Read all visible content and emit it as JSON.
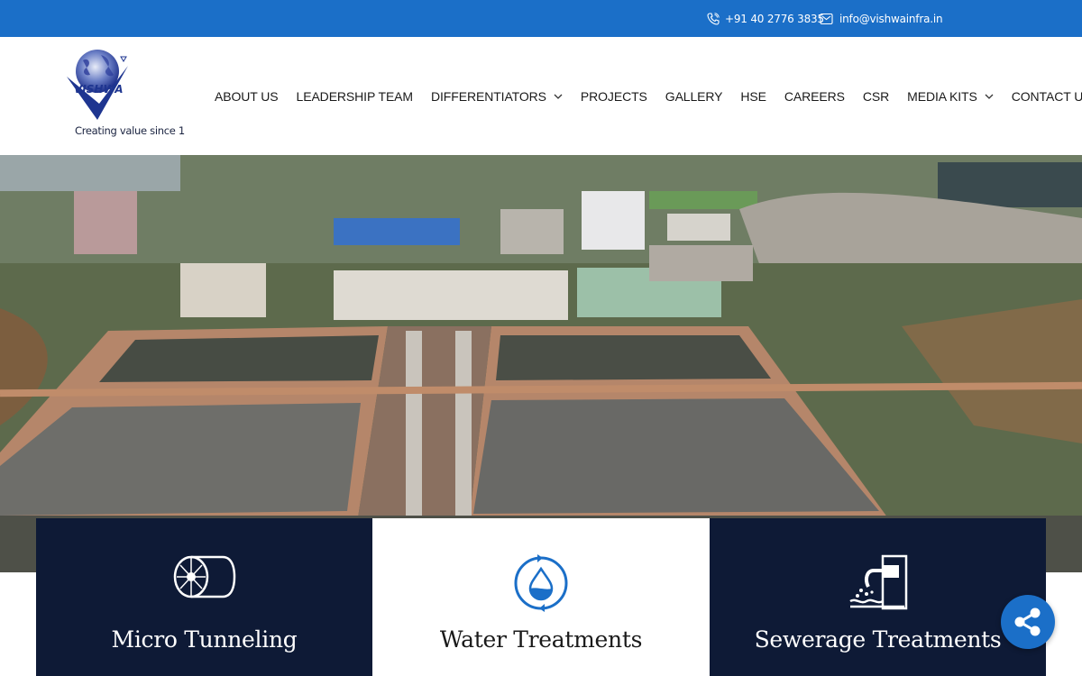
{
  "topbar": {
    "phone": "+91 40 2776 3835",
    "email": "info@vishwainfra.in",
    "phone_icon": "phone-icon",
    "email_icon": "mail-icon"
  },
  "header": {
    "logo_text": "VISHWA",
    "tagline": "Creating value since 1",
    "nav": [
      {
        "label": "ABOUT US"
      },
      {
        "label": "LEADERSHIP TEAM"
      },
      {
        "label": "DIFFERENTIATORS",
        "dropdown": true
      },
      {
        "label": "PROJECTS"
      },
      {
        "label": "GALLERY"
      },
      {
        "label": "HSE"
      },
      {
        "label": "CAREERS"
      },
      {
        "label": "CSR"
      },
      {
        "label": "MEDIA KITS",
        "dropdown": true
      },
      {
        "label": "CONTACT US"
      }
    ]
  },
  "cards": [
    {
      "title": "Micro Tunneling",
      "icon": "tunnel-icon",
      "theme": "dark"
    },
    {
      "title": "Water Treatments",
      "icon": "water-drop-cycle-icon",
      "theme": "light"
    },
    {
      "title": "Sewerage Treatments",
      "icon": "sewage-outflow-icon",
      "theme": "dark"
    }
  ],
  "colors": {
    "topbar": "#1b6fc8",
    "card_dark": "#0e1a36",
    "accent": "#1b6fc8"
  },
  "share": {
    "icon": "share-icon"
  }
}
